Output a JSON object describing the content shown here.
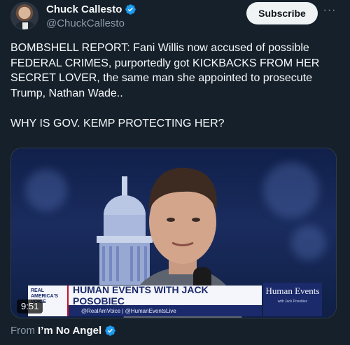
{
  "author": {
    "display_name": "Chuck Callesto",
    "handle": "@ChuckCallesto",
    "verified_color": "#1d9bf0"
  },
  "actions": {
    "subscribe_label": "Subscribe",
    "more_icon": "more-icon"
  },
  "tweet": {
    "paragraphs": [
      "BOMBSHELL REPORT: Fani Willis now accused of possible FEDERAL CRIMES, purportedly got KICKBACKS FROM HER SECRET LOVER, the same man she appointed to prosecute Trump, Nathan Wade..",
      "WHY IS GOV. KEMP PROTECTING HER?"
    ]
  },
  "media": {
    "duration": "9:51",
    "lower_third": {
      "logo_text": "REAL AMERICA'S VOICE",
      "headline": "HUMAN EVENTS WITH JACK POSOBIEC",
      "subline": "@RealAmVoice | @HumanEventsLive",
      "brand": "Human Events",
      "brand_sub": "with Jack Posobiec"
    }
  },
  "source": {
    "label": "From",
    "name": "I’m No Angel"
  }
}
